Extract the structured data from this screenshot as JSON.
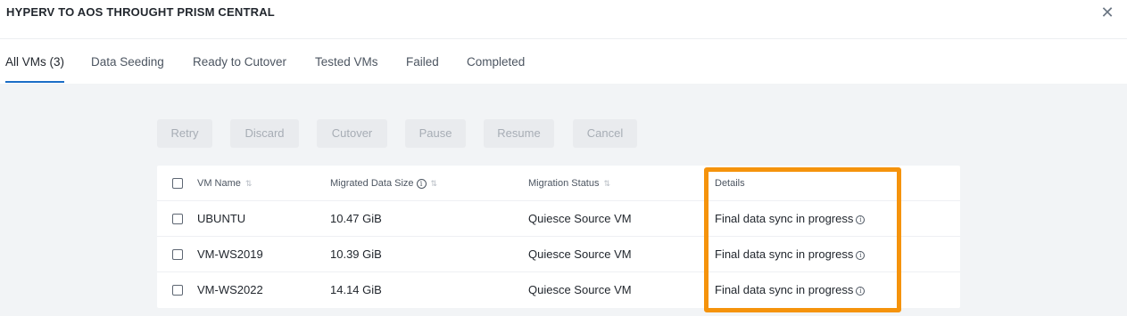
{
  "window": {
    "title": "HYPERV TO AOS THROUGHT PRISM CENTRAL",
    "close_glyph": "✕"
  },
  "tabs": [
    {
      "label": "All VMs (3)",
      "active": true
    },
    {
      "label": "Data Seeding"
    },
    {
      "label": "Ready to Cutover"
    },
    {
      "label": "Tested VMs"
    },
    {
      "label": "Failed"
    },
    {
      "label": "Completed"
    }
  ],
  "toolbar": {
    "retry": "Retry",
    "discard": "Discard",
    "cutover": "Cutover",
    "pause": "Pause",
    "resume": "Resume",
    "cancel": "Cancel"
  },
  "table": {
    "columns": {
      "vm_name": "VM Name",
      "migrated_data_size": "Migrated Data Size",
      "migration_status": "Migration Status",
      "details": "Details"
    },
    "rows": [
      {
        "vm_name": "UBUNTU",
        "size": "10.47 GiB",
        "status": "Quiesce Source VM",
        "details": "Final data sync in progress"
      },
      {
        "vm_name": "VM-WS2019",
        "size": "10.39 GiB",
        "status": "Quiesce Source VM",
        "details": "Final data sync in progress"
      },
      {
        "vm_name": "VM-WS2022",
        "size": "14.14 GiB",
        "status": "Quiesce Source VM",
        "details": "Final data sync in progress"
      }
    ]
  },
  "icons": {
    "info": "ⓘ",
    "sort": "⇅"
  },
  "colors": {
    "accent": "#1b6dc6",
    "highlight": "#f5930c"
  }
}
